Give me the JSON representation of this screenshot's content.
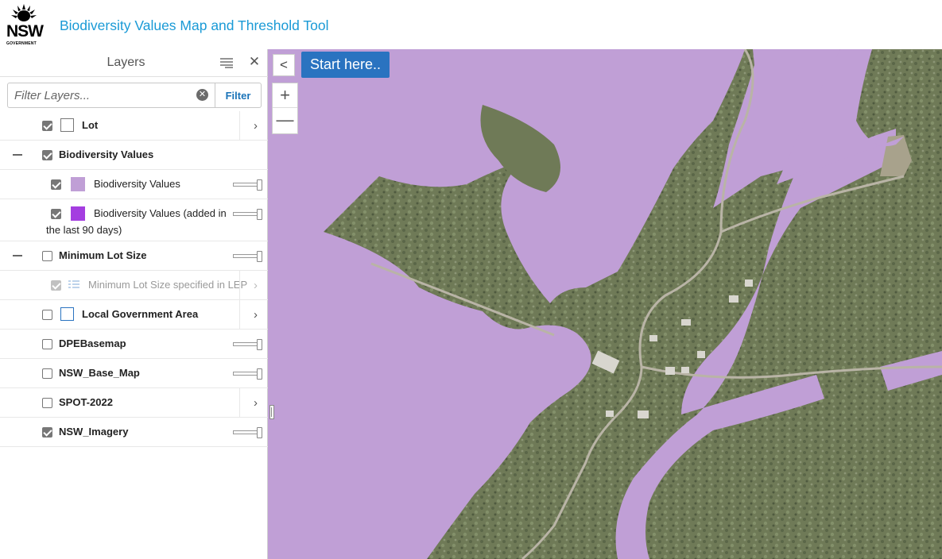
{
  "header": {
    "logo_text": "NSW",
    "logo_subtext": "GOVERNMENT",
    "title": "Biodiversity Values Map and Threshold Tool"
  },
  "panel": {
    "title": "Layers",
    "filter_placeholder": "Filter Layers...",
    "filter_button": "Filter",
    "layers": [
      {
        "label": "Lot",
        "checked": true
      },
      {
        "label": "Biodiversity Values",
        "checked": true,
        "expanded": true,
        "children": [
          {
            "label": "Biodiversity Values",
            "checked": true,
            "color": "#c09fd6"
          },
          {
            "label": "Biodiversity Values (added in",
            "label_cont": "the last 90 days)",
            "checked": true,
            "color": "#a43ee0"
          }
        ]
      },
      {
        "label": "Minimum Lot Size",
        "checked": false,
        "expanded": true,
        "children": [
          {
            "label": "Minimum Lot Size specified in LEP",
            "checked": true,
            "dimmed": true
          }
        ]
      },
      {
        "label": "Local Government Area",
        "checked": false,
        "swatch_outline": "#2a73c0"
      },
      {
        "label": "DPEBasemap",
        "checked": false
      },
      {
        "label": "NSW_Base_Map",
        "checked": false
      },
      {
        "label": "SPOT-2022",
        "checked": false
      },
      {
        "label": "NSW_Imagery",
        "checked": true
      }
    ]
  },
  "map": {
    "start_button": "Start here..",
    "zoom_in": "+",
    "zoom_out": "—",
    "collapse": "<",
    "overlay_color": "#c09fd6",
    "imagery_color": "#6f7a57"
  }
}
